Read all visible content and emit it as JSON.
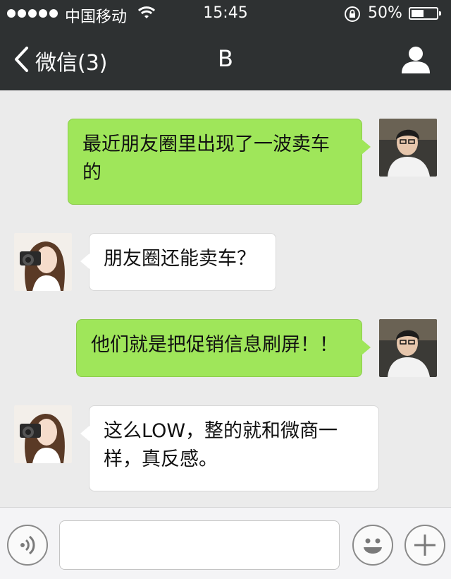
{
  "status_bar": {
    "carrier": "中国移动",
    "time": "15:45",
    "battery": "50%",
    "battery_level": 0.5
  },
  "nav": {
    "back_label": "微信(3)",
    "title": "B"
  },
  "messages": [
    {
      "side": "out",
      "text_lines": [
        "最近朋友圈里出现了一波卖车",
        "的"
      ]
    },
    {
      "side": "in",
      "text_lines": [
        "朋友圈还能卖车？"
      ]
    },
    {
      "side": "out",
      "text_lines": [
        "他们就是把促销信息刷屏！！"
      ]
    },
    {
      "side": "in",
      "text_lines": [
        "这么LOW，整的就和微商一",
        "样，真反感。"
      ]
    }
  ],
  "input": {
    "value": "",
    "placeholder": ""
  },
  "icons": {
    "back": "chevron-left-icon",
    "profile": "person-icon",
    "voice": "voice-icon",
    "emoji": "smiley-icon",
    "more": "plus-icon"
  },
  "colors": {
    "bar_background": "#2e3132",
    "chat_background": "#ebebeb",
    "outgoing_bubble": "#9fe65a",
    "incoming_bubble": "#ffffff"
  }
}
